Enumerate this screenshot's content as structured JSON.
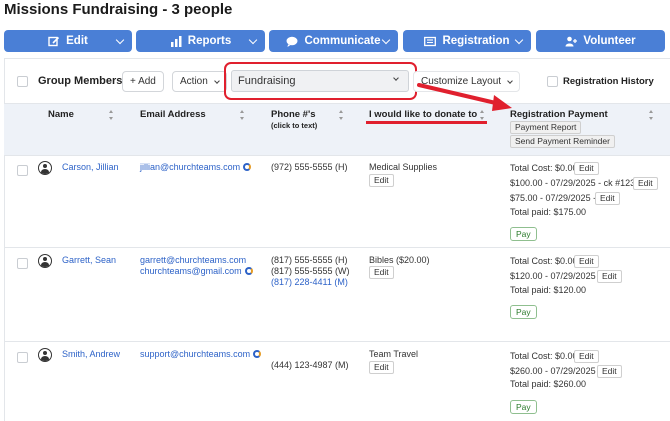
{
  "page": {
    "title": "Missions Fundraising - 3 people"
  },
  "nav": {
    "edit": "Edit",
    "reports": "Reports",
    "communicate": "Communicate",
    "registration": "Registration",
    "volunteer": "Volunteer"
  },
  "toolbar": {
    "group_members": "Group Members",
    "add": "+ Add",
    "action": "Action",
    "layout_select": "Fundraising",
    "customize": "Customize Layout",
    "registration_history": "Registration History"
  },
  "columns": {
    "name": "Name",
    "email": "Email Address",
    "phone": "Phone #'s",
    "phone_sub": "(click to text)",
    "donate": "I would like to donate to ...",
    "registration": "Registration Payment",
    "payment_report": "Payment Report",
    "send_reminder": "Send Payment Reminder"
  },
  "labels": {
    "edit": "Edit",
    "pay": "Pay"
  },
  "rows": [
    {
      "name": "Carson, Jillian",
      "emails": [
        "jillian@churchteams.com"
      ],
      "phones": [
        "(972) 555-5555 (H)"
      ],
      "donate": "Medical Supplies",
      "payments": [
        {
          "text": "Total Cost: $0.00"
        },
        {
          "text": "$100.00 - 07/29/2025 - ck #1235"
        },
        {
          "text": "$75.00 - 07/29/2025 -"
        }
      ],
      "total_paid": "Total paid: $175.00"
    },
    {
      "name": "Garrett, Sean",
      "emails": [
        "garrett@churchteams.com",
        "churchteams@gmail.com"
      ],
      "phones": [
        "(817) 555-5555 (H)",
        "(817) 555-5555 (W)",
        "(817) 228-4411 (M)"
      ],
      "donate": "Bibles ($20.00)",
      "payments": [
        {
          "text": "Total Cost: $0.00"
        },
        {
          "text": "$120.00 - 07/29/2025 -"
        }
      ],
      "total_paid": "Total paid: $120.00"
    },
    {
      "name": "Smith, Andrew",
      "emails": [
        "support@churchteams.com"
      ],
      "phones": [
        "(444) 123-4987 (M)"
      ],
      "donate": "Team Travel",
      "payments": [
        {
          "text": "Total Cost: $0.00"
        },
        {
          "text": "$260.00 - 07/29/2025 -"
        }
      ],
      "total_paid": "Total paid: $260.00"
    }
  ],
  "colors": {
    "nav_blue": "#4a7fd6",
    "link_blue": "#2e63c8",
    "annotation_red": "#e0202e",
    "header_bg": "#eef2f8"
  }
}
